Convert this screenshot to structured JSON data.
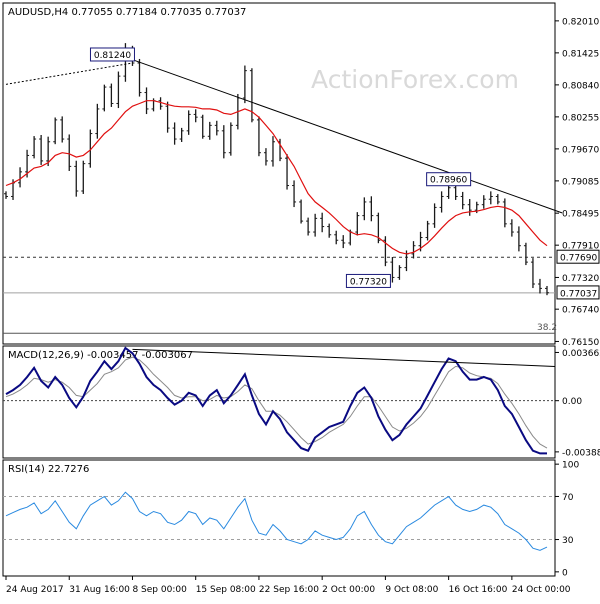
{
  "chart_data": [
    {
      "type": "ohlc",
      "panel": "price",
      "title": "AUDUSD,H4  0.77055 0.77184 0.77035 0.77037",
      "watermark": "ActionForex.com",
      "ylim": [
        0.7614,
        0.823
      ],
      "y_ticks": [
        "0.82010",
        "0.81425",
        "0.80840",
        "0.80255",
        "0.79670",
        "0.79085",
        "0.78495",
        "0.77910",
        "0.77320",
        "0.76740",
        "0.76150"
      ],
      "y_tick_values": [
        0.8201,
        0.81425,
        0.8084,
        0.80255,
        0.7967,
        0.79085,
        0.78495,
        0.7791,
        0.7732,
        0.7674,
        0.7615
      ],
      "price_labels": [
        "0.77690",
        "0.77037"
      ],
      "price_label_values": [
        0.7769,
        0.77037
      ],
      "fib_label": "38.2",
      "fib_value": 0.763,
      "horizontal_dashed": 0.7769,
      "horizontal_solid": 0.77037,
      "close_series": [
        0.788,
        0.7905,
        0.7925,
        0.7955,
        0.7985,
        0.7945,
        0.798,
        0.802,
        0.7985,
        0.7935,
        0.789,
        0.794,
        0.7995,
        0.804,
        0.808,
        0.805,
        0.81,
        0.815,
        0.8124,
        0.807,
        0.804,
        0.8055,
        0.8045,
        0.8005,
        0.7985,
        0.8,
        0.803,
        0.8025,
        0.799,
        0.801,
        0.8,
        0.796,
        0.801,
        0.806,
        0.811,
        0.802,
        0.796,
        0.7945,
        0.798,
        0.795,
        0.79,
        0.787,
        0.7835,
        0.7815,
        0.784,
        0.7825,
        0.781,
        0.78,
        0.7795,
        0.7815,
        0.7845,
        0.787,
        0.7845,
        0.78,
        0.776,
        0.7732,
        0.775,
        0.7775,
        0.779,
        0.7805,
        0.783,
        0.786,
        0.788,
        0.7896,
        0.788,
        0.7865,
        0.7855,
        0.7865,
        0.7875,
        0.788,
        0.787,
        0.783,
        0.7815,
        0.779,
        0.776,
        0.772,
        0.7712,
        0.7704
      ],
      "ma_series": [
        0.79,
        0.7905,
        0.7912,
        0.7922,
        0.7932,
        0.7935,
        0.7942,
        0.7955,
        0.796,
        0.7958,
        0.7952,
        0.7955,
        0.7965,
        0.798,
        0.7995,
        0.8005,
        0.802,
        0.8035,
        0.8045,
        0.805,
        0.8055,
        0.8055,
        0.8052,
        0.8048,
        0.8045,
        0.8044,
        0.8044,
        0.8043,
        0.804,
        0.804,
        0.8038,
        0.8032,
        0.803,
        0.8035,
        0.804,
        0.8035,
        0.8025,
        0.801,
        0.7995,
        0.7975,
        0.7955,
        0.7935,
        0.791,
        0.7885,
        0.787,
        0.786,
        0.785,
        0.7838,
        0.7825,
        0.7815,
        0.781,
        0.7812,
        0.781,
        0.7805,
        0.7795,
        0.7785,
        0.7778,
        0.7775,
        0.7778,
        0.7785,
        0.7795,
        0.7808,
        0.7822,
        0.7835,
        0.7845,
        0.785,
        0.7852,
        0.7853,
        0.7856,
        0.786,
        0.7862,
        0.786,
        0.7855,
        0.7845,
        0.783,
        0.7815,
        0.78,
        0.779
      ],
      "annotations": [
        {
          "label": "0.81240",
          "value": 0.8124,
          "index": 18
        },
        {
          "label": "0.78960",
          "value": 0.7896,
          "index": 63
        },
        {
          "label": "0.77320",
          "value": 0.7732,
          "index": 55
        }
      ],
      "trendline": {
        "start_index": 18,
        "start_value": 0.813,
        "end_index": 78,
        "end_value": 0.785
      },
      "left_dotted_line": {
        "start_index": 0,
        "start_value": 0.8085,
        "end_index": 18,
        "end_value": 0.8124
      }
    },
    {
      "type": "line",
      "panel": "macd",
      "title": "MACD(12,26,9) -0.003457 -0.003067",
      "ylim": [
        -0.0042,
        0.004
      ],
      "y_ticks": [
        "0.003662",
        "0.00",
        "-0.003887"
      ],
      "y_tick_values": [
        0.003662,
        0.0,
        -0.003887
      ],
      "series": [
        {
          "values": [
            0.0005,
            0.0008,
            0.0012,
            0.0018,
            0.0025,
            0.0015,
            0.001,
            0.0018,
            0.0012,
            0.0002,
            -0.0005,
            0.0003,
            0.0015,
            0.0022,
            0.003,
            0.0024,
            0.003,
            0.004,
            0.0036,
            0.0028,
            0.0018,
            0.0012,
            0.0008,
            0.0002,
            -0.0003,
            0.0,
            0.0006,
            0.0004,
            -0.0004,
            0.0004,
            0.0008,
            -0.0002,
            0.0004,
            0.0012,
            0.002,
            0.0004,
            -0.001,
            -0.0018,
            -0.0008,
            -0.0014,
            -0.0024,
            -0.003,
            -0.0036,
            -0.0038,
            -0.0028,
            -0.0024,
            -0.002,
            -0.0018,
            -0.0016,
            -0.0004,
            0.0006,
            0.001,
            0.0002,
            -0.0012,
            -0.0022,
            -0.003,
            -0.0026,
            -0.0018,
            -0.0012,
            -0.0006,
            0.0004,
            0.0014,
            0.0024,
            0.0032,
            0.003,
            0.0022,
            0.0016,
            0.0016,
            0.0018,
            0.0016,
            0.0008,
            -0.0004,
            -0.001,
            -0.002,
            -0.003,
            -0.0038,
            -0.004,
            -0.004
          ]
        },
        {
          "values": [
            0.0003,
            0.0005,
            0.0008,
            0.0012,
            0.0017,
            0.0016,
            0.0014,
            0.0016,
            0.0014,
            0.001,
            0.0004,
            0.0003,
            0.0008,
            0.0013,
            0.002,
            0.0022,
            0.0025,
            0.0031,
            0.0033,
            0.0031,
            0.0026,
            0.002,
            0.0015,
            0.001,
            0.0004,
            0.0002,
            0.0003,
            0.0003,
            0.0,
            0.0001,
            0.0004,
            0.0002,
            0.0003,
            0.0007,
            0.0012,
            0.0009,
            0.0,
            -0.0008,
            -0.0008,
            -0.0011,
            -0.0016,
            -0.0022,
            -0.0028,
            -0.0033,
            -0.0031,
            -0.0028,
            -0.0024,
            -0.0021,
            -0.0018,
            -0.0012,
            -0.0004,
            0.0003,
            0.0003,
            -0.0004,
            -0.0012,
            -0.002,
            -0.0023,
            -0.0021,
            -0.0017,
            -0.0012,
            -0.0005,
            0.0004,
            0.0013,
            0.0022,
            0.0026,
            0.0025,
            0.0021,
            0.0019,
            0.0018,
            0.0017,
            0.0013,
            0.0005,
            -0.0002,
            -0.001,
            -0.0019,
            -0.0027,
            -0.0033,
            -0.0036
          ]
        }
      ],
      "trendline": {
        "start_index": 18,
        "start_value": 0.0039,
        "end_index": 78,
        "end_value": 0.0026
      }
    },
    {
      "type": "line",
      "panel": "rsi",
      "title": "RSI(14) 22.7276",
      "ylim": [
        -2,
        102
      ],
      "y_ticks": [
        "100",
        "70",
        "30",
        "0"
      ],
      "y_tick_values": [
        100,
        70,
        30,
        0
      ],
      "levels": [
        70,
        30
      ],
      "series": [
        {
          "values": [
            52,
            55,
            58,
            60,
            64,
            54,
            58,
            66,
            56,
            46,
            40,
            52,
            62,
            66,
            70,
            62,
            66,
            74,
            68,
            56,
            52,
            56,
            54,
            46,
            44,
            48,
            56,
            54,
            44,
            50,
            48,
            40,
            50,
            60,
            68,
            48,
            36,
            34,
            44,
            38,
            30,
            28,
            26,
            30,
            38,
            34,
            32,
            30,
            32,
            40,
            52,
            56,
            44,
            34,
            28,
            26,
            34,
            42,
            46,
            50,
            56,
            62,
            66,
            70,
            62,
            58,
            56,
            58,
            62,
            60,
            54,
            44,
            40,
            36,
            30,
            22,
            20,
            23
          ]
        }
      ]
    }
  ],
  "x_axis": {
    "labels": [
      "24 Aug 2017",
      "31 Aug 16:00",
      "8 Sep 00:00",
      "15 Sep 08:00",
      "22 Sep 16:00",
      "2 Oct 00:00",
      "9 Oct 08:00",
      "16 Oct 16:00",
      "24 Oct 00:00"
    ],
    "label_indices": [
      0,
      9,
      18,
      27,
      36,
      45,
      54,
      63,
      72
    ]
  },
  "colors": {
    "price_bars": "#1a1a1a",
    "ma": "#e01010",
    "macd_line": "#0a0a82",
    "macd_signal": "#8a8a8a",
    "rsi_line": "#2a8ae0",
    "watermark": "#d9d9d9",
    "annotation_border": "#1a1a7a",
    "grid": "#a0a0a0",
    "panel_border": "#000000"
  }
}
